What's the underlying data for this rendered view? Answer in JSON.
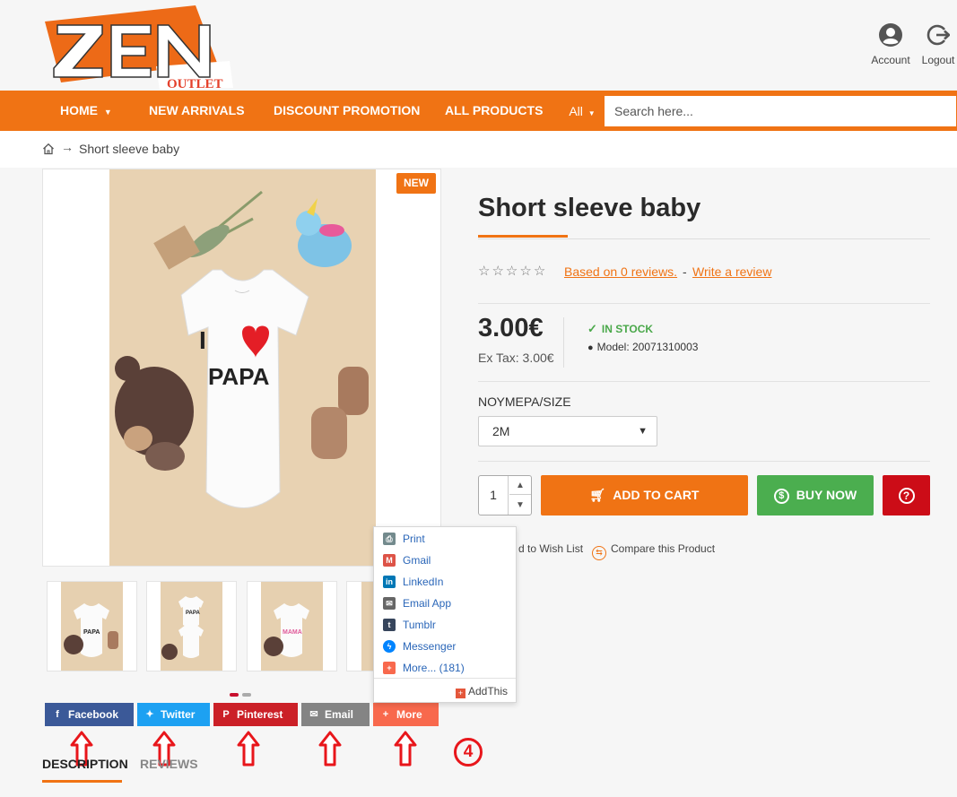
{
  "brand": {
    "logo_main": "ZEN",
    "logo_sub": "OUTLET",
    "color_primary": "#f07314",
    "color_secondary": "#e4412c"
  },
  "header": {
    "account_label": "Account",
    "account_icon": "account-circle-icon",
    "logout_label": "Logout",
    "logout_icon": "logout-icon"
  },
  "nav": {
    "items": [
      {
        "label": "HOME",
        "has_dropdown": true
      },
      {
        "label": "NEW ARRIVALS"
      },
      {
        "label": "DISCOUNT PROMOTION"
      },
      {
        "label": "ALL PRODUCTS"
      }
    ],
    "search": {
      "category": "All",
      "placeholder": "Search here..."
    }
  },
  "breadcrumb": {
    "separator": "→",
    "current": "Short sleeve baby"
  },
  "gallery": {
    "badge": "NEW",
    "main_image_caption": "I ❤ PAPA",
    "thumbnails": [
      {
        "caption": "PAPA"
      },
      {
        "caption": "PAPA"
      },
      {
        "caption": "MAMA"
      },
      {
        "caption": ""
      }
    ],
    "carousel_dots": {
      "count": 2,
      "active": 0
    }
  },
  "share": {
    "buttons": [
      {
        "label": "Facebook",
        "icon": "facebook-icon",
        "color": "#3b5998"
      },
      {
        "label": "Twitter",
        "icon": "twitter-icon",
        "color": "#1da1f2"
      },
      {
        "label": "Pinterest",
        "icon": "pinterest-icon",
        "color": "#cb2027"
      },
      {
        "label": "Email",
        "icon": "email-icon",
        "color": "#848484"
      },
      {
        "label": "More",
        "icon": "plus-icon",
        "color": "#f8694d"
      }
    ],
    "dropdown": {
      "items": [
        {
          "label": "Print",
          "icon": "print-icon",
          "color": "#738a8d"
        },
        {
          "label": "Gmail",
          "icon": "gmail-icon",
          "color": "#dd5347"
        },
        {
          "label": "LinkedIn",
          "icon": "linkedin-icon",
          "color": "#0077b5"
        },
        {
          "label": "Email App",
          "icon": "email-app-icon",
          "color": "#666666"
        },
        {
          "label": "Tumblr",
          "icon": "tumblr-icon",
          "color": "#37455c"
        },
        {
          "label": "Messenger",
          "icon": "messenger-icon",
          "color": "#0084ff"
        },
        {
          "label": "More... (181)",
          "icon": "more-icon",
          "color": "#f8694d"
        }
      ],
      "footer": "AddThis"
    },
    "step_marker": "4"
  },
  "tabs": [
    {
      "label": "DESCRIPTION",
      "active": true
    },
    {
      "label": "REVIEWS",
      "active": false
    }
  ],
  "product": {
    "title": "Short sleeve baby",
    "rating": {
      "stars": 0,
      "max": 5
    },
    "reviews_link": "Based on 0 reviews.",
    "review_separator": "-",
    "write_review_link": "Write a review",
    "price": "3.00€",
    "ex_tax": "Ex Tax: 3.00€",
    "stock": "IN STOCK",
    "model": "Model: 20071310003",
    "option_label": "ΝΟΥΜΕΡΑ/SIZE",
    "option_value": "2M",
    "quantity": "1",
    "add_to_cart": "ADD TO CART",
    "buy_now": "BUY NOW",
    "wishlist_text": "d to Wish List",
    "compare_text": "Compare this Product",
    "colors": {
      "cart": "#f07314",
      "buy": "#4bae4f",
      "question": "#cc0c17",
      "stock": "#4aa84a"
    }
  }
}
